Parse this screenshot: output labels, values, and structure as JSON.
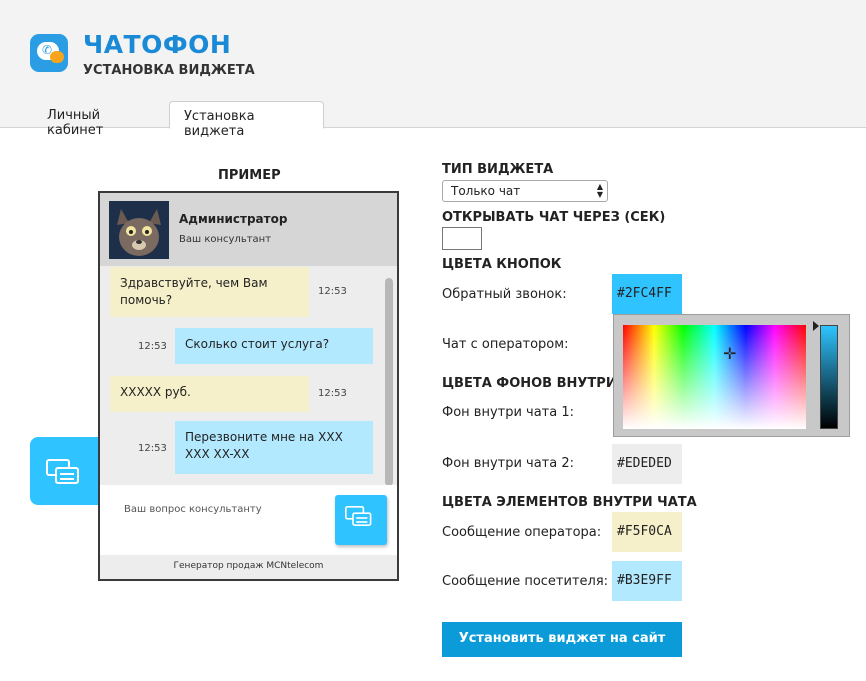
{
  "app": {
    "brand": "ЧАТОФОН",
    "subtitle": "УСТАНОВКА ВИДЖЕТА"
  },
  "tabs": [
    {
      "label": "Личный кабинет",
      "active": false
    },
    {
      "label": "Установка виджета",
      "active": true
    }
  ],
  "preview": {
    "title": "ПРИМЕР",
    "admin_name": "Администратор",
    "admin_role": "Ваш консультант",
    "messages": [
      {
        "from": "operator",
        "text": "Здравствуйте, чем Вам помочь?",
        "time": "12:53"
      },
      {
        "from": "visitor",
        "text": "Сколько стоит услуга?",
        "time": "12:53"
      },
      {
        "from": "operator",
        "text": "XXXXX руб.",
        "time": "12:53"
      },
      {
        "from": "visitor",
        "text": "Перезвоните мне на XXX XXX XX-XX",
        "time": "12:53"
      }
    ],
    "input_placeholder": "Ваш вопрос консультанту",
    "footer": "Генератор продаж MCNtelecom"
  },
  "settings": {
    "widget_type_label": "ТИП ВИДЖЕТА",
    "widget_type_value": "Только чат",
    "open_chat_label": "ОТКРЫВАТЬ ЧАТ ЧЕРЕЗ (СЕК)",
    "open_chat_value": "",
    "button_colors_label": "ЦВЕТА КНОПОК",
    "callback_label": "Обратный звонок:",
    "callback_color": "#2FC4FF",
    "chat_operator_label": "Чат с оператором:",
    "bg_colors_label": "ЦВЕТА ФОНОВ ВНУТРИ Ч",
    "bg1_label": "Фон внутри чата 1:",
    "bg2_label": "Фон внутри чата 2:",
    "bg2_color": "#EDEDED",
    "elem_colors_label": "ЦВЕТА ЭЛЕМЕНТОВ ВНУТРИ ЧАТА",
    "op_msg_label": "Сообщение оператора:",
    "op_msg_color": "#F5F0CA",
    "vis_msg_label": "Сообщение посетителя:",
    "vis_msg_color": "#B3E9FF",
    "install_button": "Установить виджет на сайт"
  },
  "colors": {
    "brand": "#1a8ad6",
    "accent": "#2fc4ff",
    "install_button": "#0a9bd8"
  },
  "icons": [
    "chatofon-logo-icon",
    "chat-bubbles-icon",
    "crosshair-icon",
    "select-arrows-icon"
  ]
}
